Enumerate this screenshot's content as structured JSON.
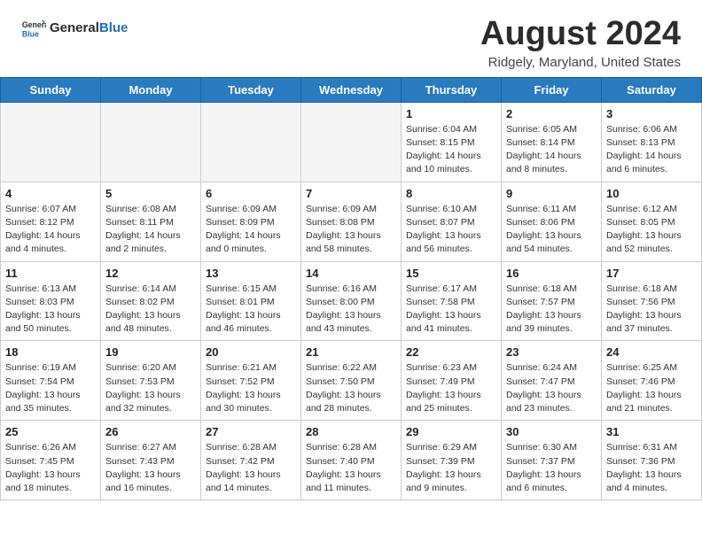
{
  "header": {
    "logo_general": "General",
    "logo_blue": "Blue",
    "month_title": "August 2024",
    "subtitle": "Ridgely, Maryland, United States"
  },
  "weekdays": [
    "Sunday",
    "Monday",
    "Tuesday",
    "Wednesday",
    "Thursday",
    "Friday",
    "Saturday"
  ],
  "weeks": [
    [
      {
        "day": "",
        "empty": true
      },
      {
        "day": "",
        "empty": true
      },
      {
        "day": "",
        "empty": true
      },
      {
        "day": "",
        "empty": true
      },
      {
        "day": "1",
        "lines": [
          "Sunrise: 6:04 AM",
          "Sunset: 8:15 PM",
          "Daylight: 14 hours",
          "and 10 minutes."
        ]
      },
      {
        "day": "2",
        "lines": [
          "Sunrise: 6:05 AM",
          "Sunset: 8:14 PM",
          "Daylight: 14 hours",
          "and 8 minutes."
        ]
      },
      {
        "day": "3",
        "lines": [
          "Sunrise: 6:06 AM",
          "Sunset: 8:13 PM",
          "Daylight: 14 hours",
          "and 6 minutes."
        ]
      }
    ],
    [
      {
        "day": "4",
        "lines": [
          "Sunrise: 6:07 AM",
          "Sunset: 8:12 PM",
          "Daylight: 14 hours",
          "and 4 minutes."
        ]
      },
      {
        "day": "5",
        "lines": [
          "Sunrise: 6:08 AM",
          "Sunset: 8:11 PM",
          "Daylight: 14 hours",
          "and 2 minutes."
        ]
      },
      {
        "day": "6",
        "lines": [
          "Sunrise: 6:09 AM",
          "Sunset: 8:09 PM",
          "Daylight: 14 hours",
          "and 0 minutes."
        ]
      },
      {
        "day": "7",
        "lines": [
          "Sunrise: 6:09 AM",
          "Sunset: 8:08 PM",
          "Daylight: 13 hours",
          "and 58 minutes."
        ]
      },
      {
        "day": "8",
        "lines": [
          "Sunrise: 6:10 AM",
          "Sunset: 8:07 PM",
          "Daylight: 13 hours",
          "and 56 minutes."
        ]
      },
      {
        "day": "9",
        "lines": [
          "Sunrise: 6:11 AM",
          "Sunset: 8:06 PM",
          "Daylight: 13 hours",
          "and 54 minutes."
        ]
      },
      {
        "day": "10",
        "lines": [
          "Sunrise: 6:12 AM",
          "Sunset: 8:05 PM",
          "Daylight: 13 hours",
          "and 52 minutes."
        ]
      }
    ],
    [
      {
        "day": "11",
        "lines": [
          "Sunrise: 6:13 AM",
          "Sunset: 8:03 PM",
          "Daylight: 13 hours",
          "and 50 minutes."
        ]
      },
      {
        "day": "12",
        "lines": [
          "Sunrise: 6:14 AM",
          "Sunset: 8:02 PM",
          "Daylight: 13 hours",
          "and 48 minutes."
        ]
      },
      {
        "day": "13",
        "lines": [
          "Sunrise: 6:15 AM",
          "Sunset: 8:01 PM",
          "Daylight: 13 hours",
          "and 46 minutes."
        ]
      },
      {
        "day": "14",
        "lines": [
          "Sunrise: 6:16 AM",
          "Sunset: 8:00 PM",
          "Daylight: 13 hours",
          "and 43 minutes."
        ]
      },
      {
        "day": "15",
        "lines": [
          "Sunrise: 6:17 AM",
          "Sunset: 7:58 PM",
          "Daylight: 13 hours",
          "and 41 minutes."
        ]
      },
      {
        "day": "16",
        "lines": [
          "Sunrise: 6:18 AM",
          "Sunset: 7:57 PM",
          "Daylight: 13 hours",
          "and 39 minutes."
        ]
      },
      {
        "day": "17",
        "lines": [
          "Sunrise: 6:18 AM",
          "Sunset: 7:56 PM",
          "Daylight: 13 hours",
          "and 37 minutes."
        ]
      }
    ],
    [
      {
        "day": "18",
        "lines": [
          "Sunrise: 6:19 AM",
          "Sunset: 7:54 PM",
          "Daylight: 13 hours",
          "and 35 minutes."
        ]
      },
      {
        "day": "19",
        "lines": [
          "Sunrise: 6:20 AM",
          "Sunset: 7:53 PM",
          "Daylight: 13 hours",
          "and 32 minutes."
        ]
      },
      {
        "day": "20",
        "lines": [
          "Sunrise: 6:21 AM",
          "Sunset: 7:52 PM",
          "Daylight: 13 hours",
          "and 30 minutes."
        ]
      },
      {
        "day": "21",
        "lines": [
          "Sunrise: 6:22 AM",
          "Sunset: 7:50 PM",
          "Daylight: 13 hours",
          "and 28 minutes."
        ]
      },
      {
        "day": "22",
        "lines": [
          "Sunrise: 6:23 AM",
          "Sunset: 7:49 PM",
          "Daylight: 13 hours",
          "and 25 minutes."
        ]
      },
      {
        "day": "23",
        "lines": [
          "Sunrise: 6:24 AM",
          "Sunset: 7:47 PM",
          "Daylight: 13 hours",
          "and 23 minutes."
        ]
      },
      {
        "day": "24",
        "lines": [
          "Sunrise: 6:25 AM",
          "Sunset: 7:46 PM",
          "Daylight: 13 hours",
          "and 21 minutes."
        ]
      }
    ],
    [
      {
        "day": "25",
        "lines": [
          "Sunrise: 6:26 AM",
          "Sunset: 7:45 PM",
          "Daylight: 13 hours",
          "and 18 minutes."
        ]
      },
      {
        "day": "26",
        "lines": [
          "Sunrise: 6:27 AM",
          "Sunset: 7:43 PM",
          "Daylight: 13 hours",
          "and 16 minutes."
        ]
      },
      {
        "day": "27",
        "lines": [
          "Sunrise: 6:28 AM",
          "Sunset: 7:42 PM",
          "Daylight: 13 hours",
          "and 14 minutes."
        ]
      },
      {
        "day": "28",
        "lines": [
          "Sunrise: 6:28 AM",
          "Sunset: 7:40 PM",
          "Daylight: 13 hours",
          "and 11 minutes."
        ]
      },
      {
        "day": "29",
        "lines": [
          "Sunrise: 6:29 AM",
          "Sunset: 7:39 PM",
          "Daylight: 13 hours",
          "and 9 minutes."
        ]
      },
      {
        "day": "30",
        "lines": [
          "Sunrise: 6:30 AM",
          "Sunset: 7:37 PM",
          "Daylight: 13 hours",
          "and 6 minutes."
        ]
      },
      {
        "day": "31",
        "lines": [
          "Sunrise: 6:31 AM",
          "Sunset: 7:36 PM",
          "Daylight: 13 hours",
          "and 4 minutes."
        ]
      }
    ]
  ]
}
